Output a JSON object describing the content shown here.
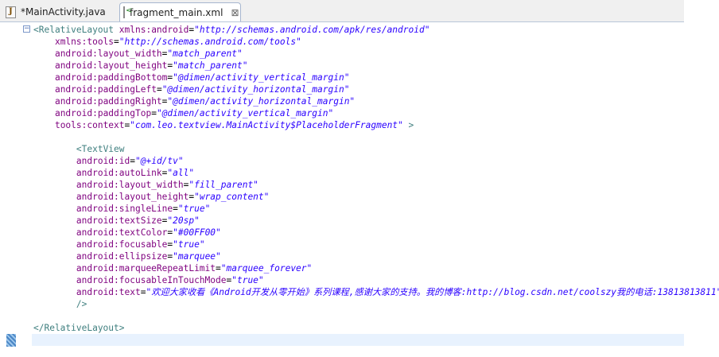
{
  "tabs": [
    {
      "label": "*MainActivity.java",
      "icon": "java-file-icon"
    },
    {
      "label": "fragment_main.xml",
      "icon": "xml-file-icon",
      "active": true,
      "close": "⊠"
    }
  ],
  "colors": {
    "tag": "#3f7f7f",
    "attr_name": "#7f007f",
    "attr_value": "#2a00ff",
    "current_line": "#e8f2fe"
  },
  "code": {
    "lines": [
      {
        "indent": "",
        "segments": [
          [
            "tag",
            "<RelativeLayout "
          ],
          [
            "an",
            "xmlns:android"
          ],
          [
            "p",
            "="
          ],
          [
            "av",
            "\"http://schemas.android.com/apk/res/android\""
          ]
        ]
      },
      {
        "indent": "    ",
        "segments": [
          [
            "an",
            "xmlns:tools"
          ],
          [
            "p",
            "="
          ],
          [
            "av",
            "\"http://schemas.android.com/tools\""
          ]
        ]
      },
      {
        "indent": "    ",
        "segments": [
          [
            "an",
            "android:layout_width"
          ],
          [
            "p",
            "="
          ],
          [
            "av",
            "\"match_parent\""
          ]
        ]
      },
      {
        "indent": "    ",
        "segments": [
          [
            "an",
            "android:layout_height"
          ],
          [
            "p",
            "="
          ],
          [
            "av",
            "\"match_parent\""
          ]
        ]
      },
      {
        "indent": "    ",
        "segments": [
          [
            "an",
            "android:paddingBottom"
          ],
          [
            "p",
            "="
          ],
          [
            "av",
            "\"@dimen/activity_vertical_margin\""
          ]
        ]
      },
      {
        "indent": "    ",
        "segments": [
          [
            "an",
            "android:paddingLeft"
          ],
          [
            "p",
            "="
          ],
          [
            "av",
            "\"@dimen/activity_horizontal_margin\""
          ]
        ]
      },
      {
        "indent": "    ",
        "segments": [
          [
            "an",
            "android:paddingRight"
          ],
          [
            "p",
            "="
          ],
          [
            "av",
            "\"@dimen/activity_horizontal_margin\""
          ]
        ]
      },
      {
        "indent": "    ",
        "segments": [
          [
            "an",
            "android:paddingTop"
          ],
          [
            "p",
            "="
          ],
          [
            "av",
            "\"@dimen/activity_vertical_margin\""
          ]
        ]
      },
      {
        "indent": "    ",
        "segments": [
          [
            "an",
            "tools:context"
          ],
          [
            "p",
            "="
          ],
          [
            "av",
            "\"com.leo.textview.MainActivity$PlaceholderFragment\""
          ],
          [
            "tag",
            " >"
          ]
        ]
      },
      {
        "indent": "",
        "segments": []
      },
      {
        "indent": "        ",
        "segments": [
          [
            "tag",
            "<TextView"
          ]
        ]
      },
      {
        "indent": "        ",
        "segments": [
          [
            "an",
            "android:id"
          ],
          [
            "p",
            "="
          ],
          [
            "av",
            "\"@+id/tv\""
          ]
        ]
      },
      {
        "indent": "        ",
        "segments": [
          [
            "an",
            "android:autoLink"
          ],
          [
            "p",
            "="
          ],
          [
            "av",
            "\"all\""
          ]
        ]
      },
      {
        "indent": "        ",
        "segments": [
          [
            "an",
            "android:layout_width"
          ],
          [
            "p",
            "="
          ],
          [
            "av",
            "\"fill_parent\""
          ]
        ]
      },
      {
        "indent": "        ",
        "segments": [
          [
            "an",
            "android:layout_height"
          ],
          [
            "p",
            "="
          ],
          [
            "av",
            "\"wrap_content\""
          ]
        ]
      },
      {
        "indent": "        ",
        "segments": [
          [
            "an",
            "android:singleLine"
          ],
          [
            "p",
            "="
          ],
          [
            "av",
            "\"true\""
          ]
        ]
      },
      {
        "indent": "        ",
        "segments": [
          [
            "an",
            "android:textSize"
          ],
          [
            "p",
            "="
          ],
          [
            "av",
            "\"20sp\""
          ]
        ]
      },
      {
        "indent": "        ",
        "segments": [
          [
            "an",
            "android:textColor"
          ],
          [
            "p",
            "="
          ],
          [
            "av",
            "\"#00FF00\""
          ]
        ]
      },
      {
        "indent": "        ",
        "segments": [
          [
            "an",
            "android:focusable"
          ],
          [
            "p",
            "="
          ],
          [
            "av",
            "\"true\""
          ]
        ]
      },
      {
        "indent": "        ",
        "segments": [
          [
            "an",
            "android:ellipsize"
          ],
          [
            "p",
            "="
          ],
          [
            "av",
            "\"marquee\""
          ]
        ]
      },
      {
        "indent": "        ",
        "segments": [
          [
            "an",
            "android:marqueeRepeatLimit"
          ],
          [
            "p",
            "="
          ],
          [
            "av",
            "\"marquee_forever\""
          ]
        ]
      },
      {
        "indent": "        ",
        "segments": [
          [
            "an",
            "android:focusableInTouchMode"
          ],
          [
            "p",
            "="
          ],
          [
            "av",
            "\"true\""
          ]
        ]
      },
      {
        "indent": "        ",
        "segments": [
          [
            "an",
            "android:text"
          ],
          [
            "p",
            "="
          ],
          [
            "av",
            "\"欢迎大家收看《Android开发从零开始》系列课程,感谢大家的支持。我的博客:http://blog.csdn.net/coolszy我的电话:13813813811\""
          ]
        ]
      },
      {
        "indent": "        ",
        "segments": [
          [
            "tag",
            "/>"
          ]
        ]
      },
      {
        "indent": "",
        "segments": []
      },
      {
        "indent": "",
        "segments": [
          [
            "tag",
            "</RelativeLayout>"
          ]
        ]
      },
      {
        "indent": "",
        "segments": []
      }
    ]
  }
}
